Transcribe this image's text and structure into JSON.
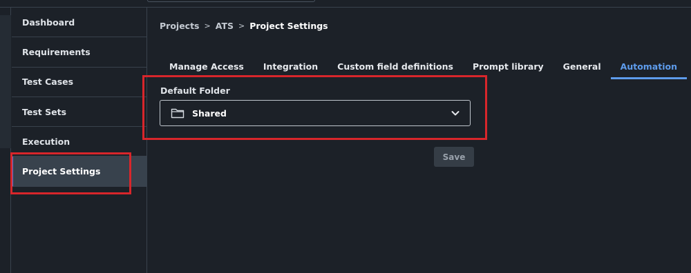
{
  "sidebar": {
    "items": [
      {
        "label": "Dashboard"
      },
      {
        "label": "Requirements"
      },
      {
        "label": "Test Cases"
      },
      {
        "label": "Test Sets"
      },
      {
        "label": "Execution"
      },
      {
        "label": "Project Settings"
      }
    ],
    "active_index": 5
  },
  "breadcrumb": {
    "items": [
      "Projects",
      "ATS"
    ],
    "separator": ">",
    "current": "Project Settings"
  },
  "tabs": [
    {
      "label": "Manage Access"
    },
    {
      "label": "Integration"
    },
    {
      "label": "Custom field definitions"
    },
    {
      "label": "Prompt library"
    },
    {
      "label": "General"
    },
    {
      "label": "Automation"
    }
  ],
  "active_tab_index": 5,
  "default_folder": {
    "label": "Default Folder",
    "value": "Shared",
    "icon": "folder-icon",
    "dropdown_icon": "chevron-down-icon"
  },
  "actions": {
    "save_label": "Save"
  },
  "colors": {
    "background": "#1c2128",
    "accent": "#5e9cec",
    "highlight": "#d8262b",
    "active_item": "#38424d"
  }
}
